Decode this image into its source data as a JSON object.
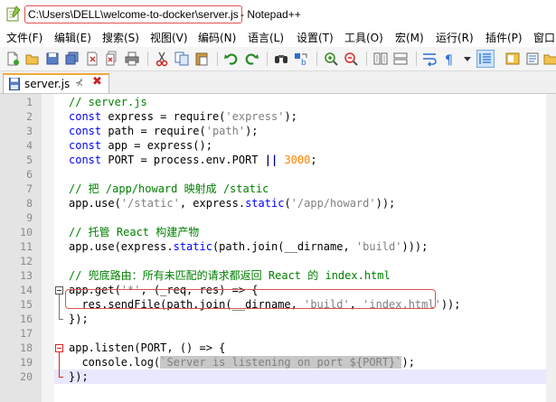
{
  "window": {
    "title_path": "C:\\Users\\DELL\\welcome-to-docker\\server.js",
    "title_suffix": "- Notepad++"
  },
  "menu": [
    {
      "label": "文件(F)"
    },
    {
      "label": "编辑(E)"
    },
    {
      "label": "搜索(S)"
    },
    {
      "label": "视图(V)"
    },
    {
      "label": "编码(N)"
    },
    {
      "label": "语言(L)"
    },
    {
      "label": "设置(T)"
    },
    {
      "label": "工具(O)"
    },
    {
      "label": "宏(M)"
    },
    {
      "label": "运行(R)"
    },
    {
      "label": "插件(P)"
    },
    {
      "label": "窗口"
    }
  ],
  "tab": {
    "label": "server.js",
    "pin_glyph": "⊀",
    "close_glyph": "✖"
  },
  "colors": {
    "highlight_border": "#e0524f",
    "comment": "#008000",
    "keyword": "#0000ff",
    "string": "#808080",
    "number": "#ff8000",
    "current_line": "#e8e8ff"
  },
  "editor": {
    "current_line": 20,
    "lines": [
      {
        "n": "1",
        "code": "// server.js"
      },
      {
        "n": "2",
        "code": "const express = require('express');"
      },
      {
        "n": "3",
        "code": "const path = require('path');"
      },
      {
        "n": "4",
        "code": "const app = express();"
      },
      {
        "n": "5",
        "code": "const PORT = process.env.PORT || 3000;"
      },
      {
        "n": "6",
        "code": ""
      },
      {
        "n": "7",
        "code": "// 把 /app/howard 映射成 /static"
      },
      {
        "n": "8",
        "code": "app.use('/static', express.static('/app/howard'));"
      },
      {
        "n": "9",
        "code": ""
      },
      {
        "n": "10",
        "code": "// 托管 React 构建产物"
      },
      {
        "n": "11",
        "code": "app.use(express.static(path.join(__dirname, 'build')));"
      },
      {
        "n": "12",
        "code": ""
      },
      {
        "n": "13",
        "code": "// 兜底路由：所有未匹配的请求都返回 React 的 index.html"
      },
      {
        "n": "14",
        "code": "app.get('*', (_req, res) => {"
      },
      {
        "n": "15",
        "code": "  res.sendFile(path.join(__dirname, 'build', 'index.html'));"
      },
      {
        "n": "16",
        "code": "});"
      },
      {
        "n": "17",
        "code": ""
      },
      {
        "n": "18",
        "code": "app.listen(PORT, () => {"
      },
      {
        "n": "19",
        "code": "  console.log(`Server is listening on port ${PORT}`);"
      },
      {
        "n": "20",
        "code": "});"
      }
    ]
  }
}
